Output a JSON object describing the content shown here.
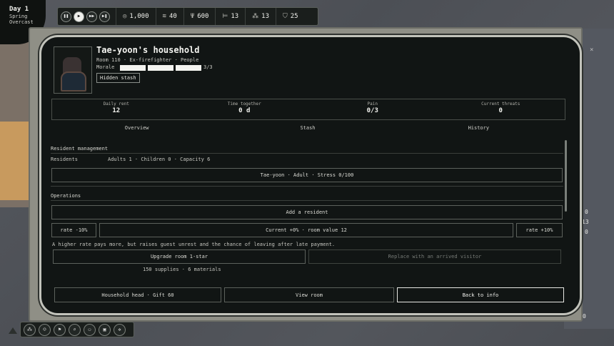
{
  "day": {
    "title": "Day 1",
    "season": "Spring",
    "weather": "Overcast"
  },
  "controls": [
    {
      "icon": "pause-icon",
      "glyph": "❚❚"
    },
    {
      "icon": "play-icon",
      "glyph": "▶"
    },
    {
      "icon": "fast-forward-icon",
      "glyph": "▶▶"
    },
    {
      "icon": "skip-icon",
      "glyph": "▶❚"
    }
  ],
  "resources": [
    {
      "icon": "coin-icon",
      "glyph": "◎",
      "value": "1,000"
    },
    {
      "icon": "stack-icon",
      "glyph": "≋",
      "value": "40"
    },
    {
      "icon": "food-icon",
      "glyph": "Ψ",
      "value": "600"
    },
    {
      "icon": "bed-icon",
      "glyph": "⊨",
      "value": "13"
    },
    {
      "icon": "people-icon",
      "glyph": "⁂",
      "value": "13"
    },
    {
      "icon": "shield-icon",
      "glyph": "⛉",
      "value": "25"
    }
  ],
  "side_values": [
    "0",
    "13",
    "0",
    "0"
  ],
  "household": {
    "title": "Tae-yoon's household",
    "subtitle": "Room 110 · Ex-firefighter · People",
    "morale_label": "Morale",
    "morale_count": "3/3",
    "morale_fill": 1.0,
    "stash_badge": "Hidden stash"
  },
  "stats": [
    {
      "label": "Daily rent",
      "value": "12"
    },
    {
      "label": "Time together",
      "value": "0 d"
    },
    {
      "label": "Pain",
      "value": "0/3"
    },
    {
      "label": "Current threats",
      "value": "0"
    }
  ],
  "tabs": [
    "Overview",
    "Stash",
    "History"
  ],
  "resident_management": {
    "title": "Resident management",
    "residents_label": "Residents",
    "counts": "Adults 1 · Children 0 · Capacity 6",
    "resident_row": "Tae-yoon · Adult · Stress 0/100"
  },
  "operations": {
    "title": "Operations",
    "add_resident": "Add a resident",
    "rate_down": "rate -10%",
    "rate_current": "Current +0% · room value 12",
    "rate_up": "rate +10%",
    "hint": "A higher rate pays more, but raises guest unrest and the chance of leaving after late payment.",
    "upgrade": "Upgrade room 1-star",
    "replace": "Replace with an arrived visitor",
    "upgrade_cost": "150 supplies · 6 materials"
  },
  "footer": {
    "head": "Household head · Gift 60",
    "view_room": "View room",
    "back": "Back to info"
  },
  "tools": [
    {
      "icon": "group-icon",
      "glyph": "⁂"
    },
    {
      "icon": "face-icon",
      "glyph": "☺"
    },
    {
      "icon": "flag-icon",
      "glyph": "⚑"
    },
    {
      "icon": "search-icon",
      "glyph": "⌕"
    },
    {
      "icon": "magnify-people-icon",
      "glyph": "⚇"
    },
    {
      "icon": "screen-icon",
      "glyph": "▣"
    },
    {
      "icon": "settings-icon",
      "glyph": "✲"
    }
  ],
  "close_glyph": "×"
}
